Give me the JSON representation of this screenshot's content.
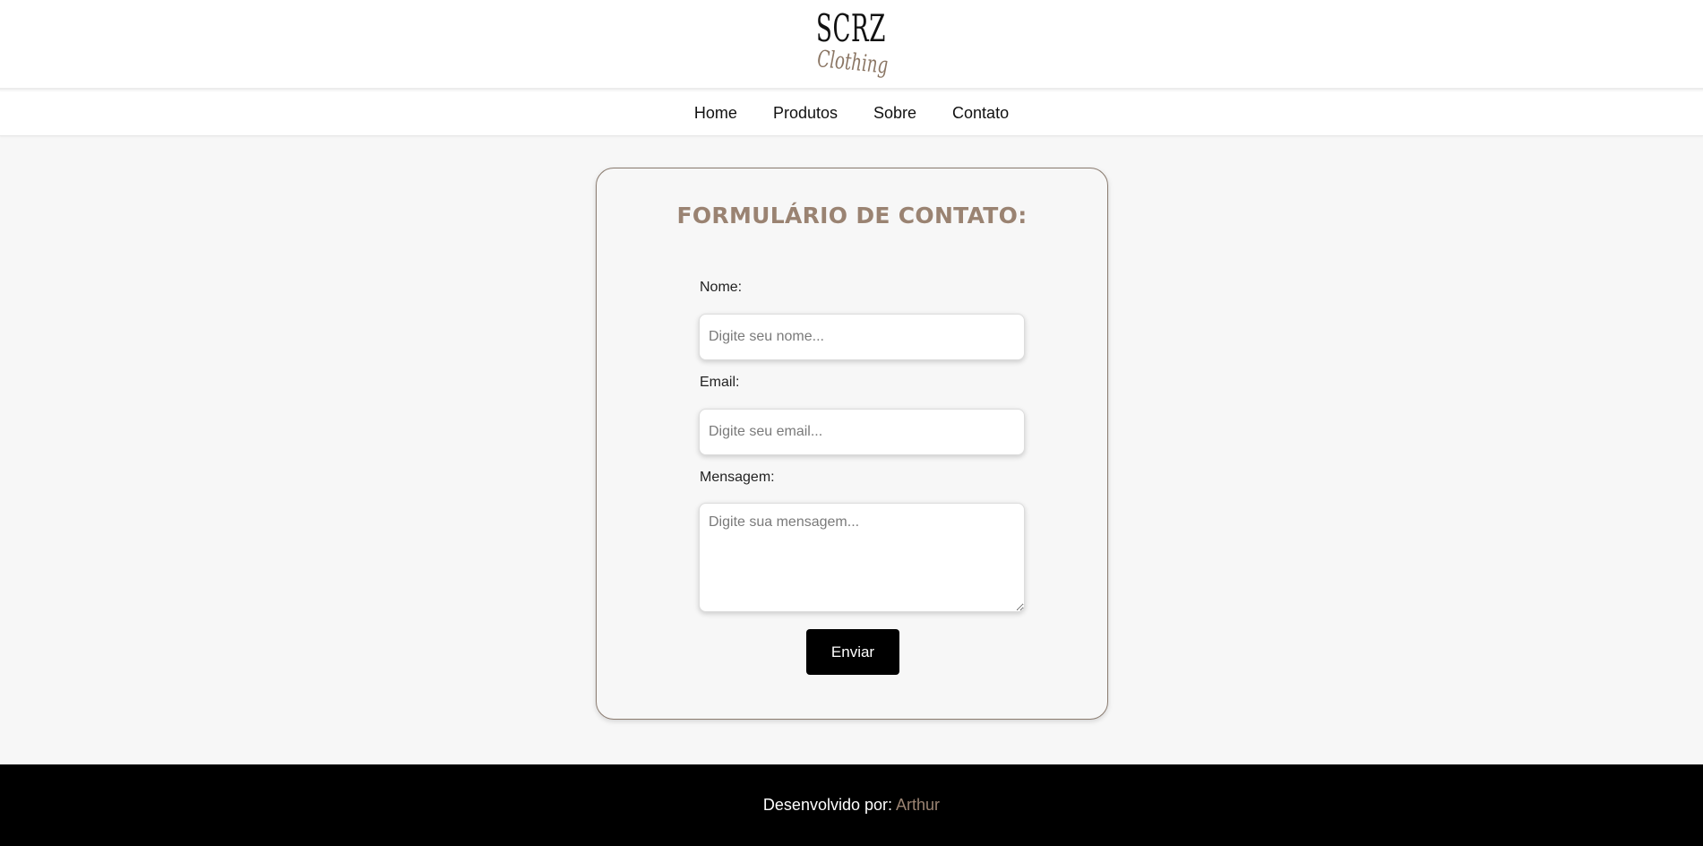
{
  "header": {
    "logo_main": "SCRZ",
    "logo_sub": "Clothing"
  },
  "nav": {
    "items": [
      {
        "label": "Home"
      },
      {
        "label": "Produtos"
      },
      {
        "label": "Sobre"
      },
      {
        "label": "Contato"
      }
    ]
  },
  "form": {
    "title": "FORMULÁRIO DE CONTATO:",
    "name": {
      "label": "Nome:",
      "value": "",
      "placeholder": "Digite seu nome..."
    },
    "email": {
      "label": "Email:",
      "value": "",
      "placeholder": "Digite seu email..."
    },
    "message": {
      "label": "Mensagem:",
      "value": "",
      "placeholder": "Digite sua mensagem..."
    },
    "submit_label": "Enviar"
  },
  "footer": {
    "prefix": "Desenvolvido por:",
    "author": "Arthur"
  },
  "colors": {
    "accent": "#9a8372",
    "background": "#f7f7f7",
    "footer_bg": "#000000",
    "button_bg": "#000000"
  }
}
